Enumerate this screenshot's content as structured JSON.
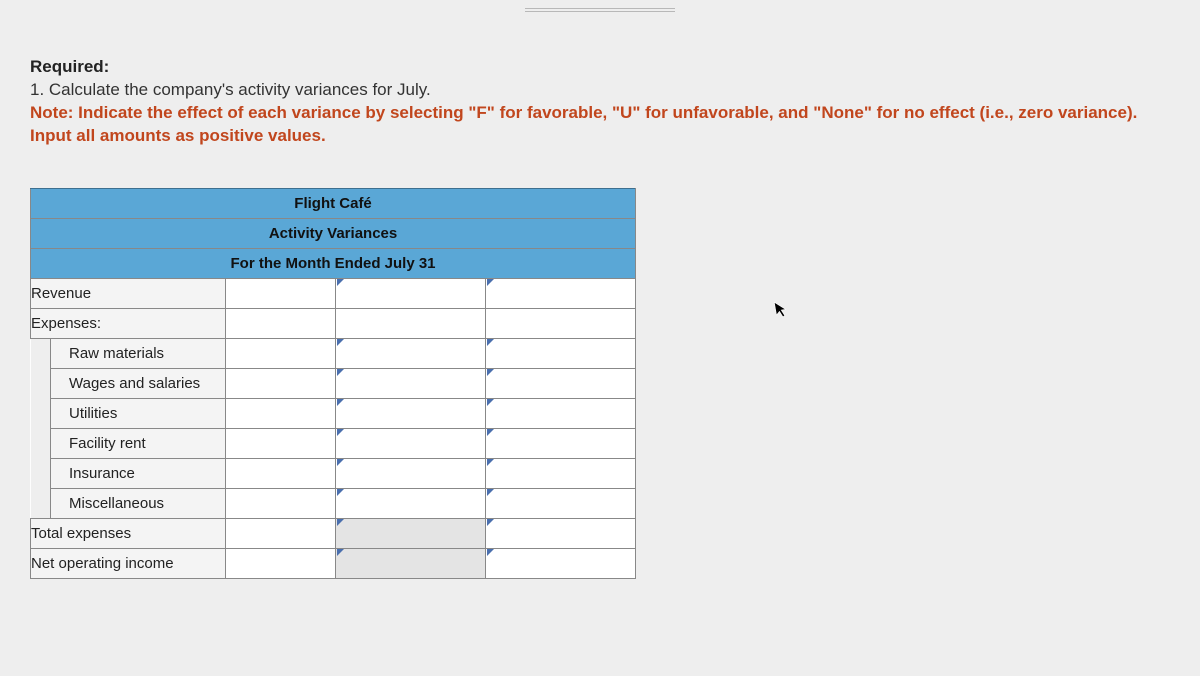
{
  "instructions": {
    "required_label": "Required:",
    "question": "1. Calculate the company's activity variances for July.",
    "note": "Note: Indicate the effect of each variance by selecting \"F\" for favorable, \"U\" for unfavorable, and \"None\" for no effect (i.e., zero variance). Input all amounts as positive values."
  },
  "table": {
    "header1": "Flight Café",
    "header2": "Activity Variances",
    "header3": "For the Month Ended July 31",
    "rows": {
      "revenue": "Revenue",
      "expenses": "Expenses:",
      "raw_materials": "Raw materials",
      "wages": "Wages and salaries",
      "utilities": "Utilities",
      "facility_rent": "Facility rent",
      "insurance": "Insurance",
      "misc": "Miscellaneous",
      "total_expenses": "Total expenses",
      "net_income": "Net operating income"
    }
  }
}
